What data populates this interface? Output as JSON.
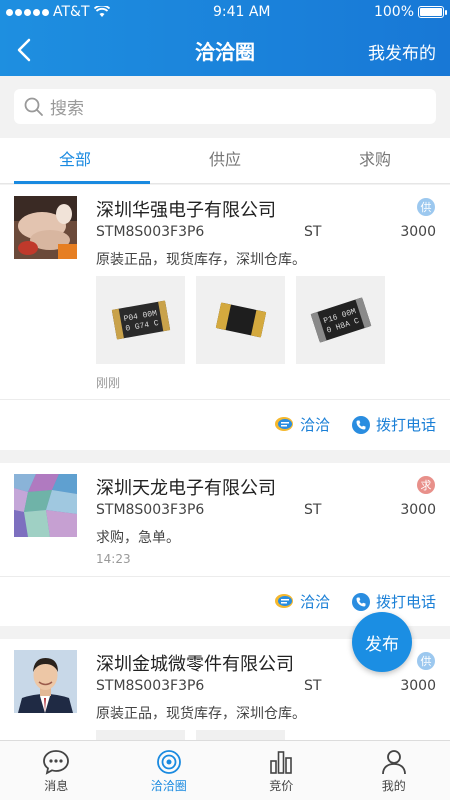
{
  "status_bar": {
    "carrier": "AT&T",
    "time": "9:41 AM",
    "battery": "100%"
  },
  "header": {
    "title": "洽洽圈",
    "right_action": "我发布的"
  },
  "search": {
    "placeholder": "搜索"
  },
  "tabs": [
    {
      "label": "全部",
      "active": true
    },
    {
      "label": "供应",
      "active": false
    },
    {
      "label": "求购",
      "active": false
    }
  ],
  "posts": [
    {
      "company": "深圳华强电子有限公司",
      "badge": "供",
      "part": "STM8S003F3P6",
      "brand": "ST",
      "quantity": "3000",
      "description": "原装正品，现货库存，深圳仓库。",
      "time": "刚刚",
      "chat_label": "洽洽",
      "call_label": "拨打电话",
      "photo_marks": [
        "P04 00M\n0 G74 C",
        "",
        "P16 00M\n0 H8A C"
      ]
    },
    {
      "company": "深圳天龙电子有限公司",
      "badge": "求",
      "part": "STM8S003F3P6",
      "brand": "ST",
      "quantity": "3000",
      "description": "求购，急单。",
      "time": "14:23",
      "chat_label": "洽洽",
      "call_label": "拨打电话"
    },
    {
      "company": "深圳金城微零件有限公司",
      "badge": "供",
      "part": "STM8S003F3P6",
      "brand": "ST",
      "quantity": "3000",
      "description": "原装正品，现货库存，深圳仓库。"
    }
  ],
  "fab": {
    "label": "发布"
  },
  "bottom_nav": [
    {
      "label": "消息",
      "icon": "message-icon",
      "active": false
    },
    {
      "label": "洽洽圈",
      "icon": "circle-icon",
      "active": true
    },
    {
      "label": "竞价",
      "icon": "bar-chart-icon",
      "active": false
    },
    {
      "label": "我的",
      "icon": "user-icon",
      "active": false
    }
  ],
  "colors": {
    "primary": "#1a8ae0",
    "supply_badge": "#9cc8ef",
    "want_badge": "#e8908a"
  }
}
